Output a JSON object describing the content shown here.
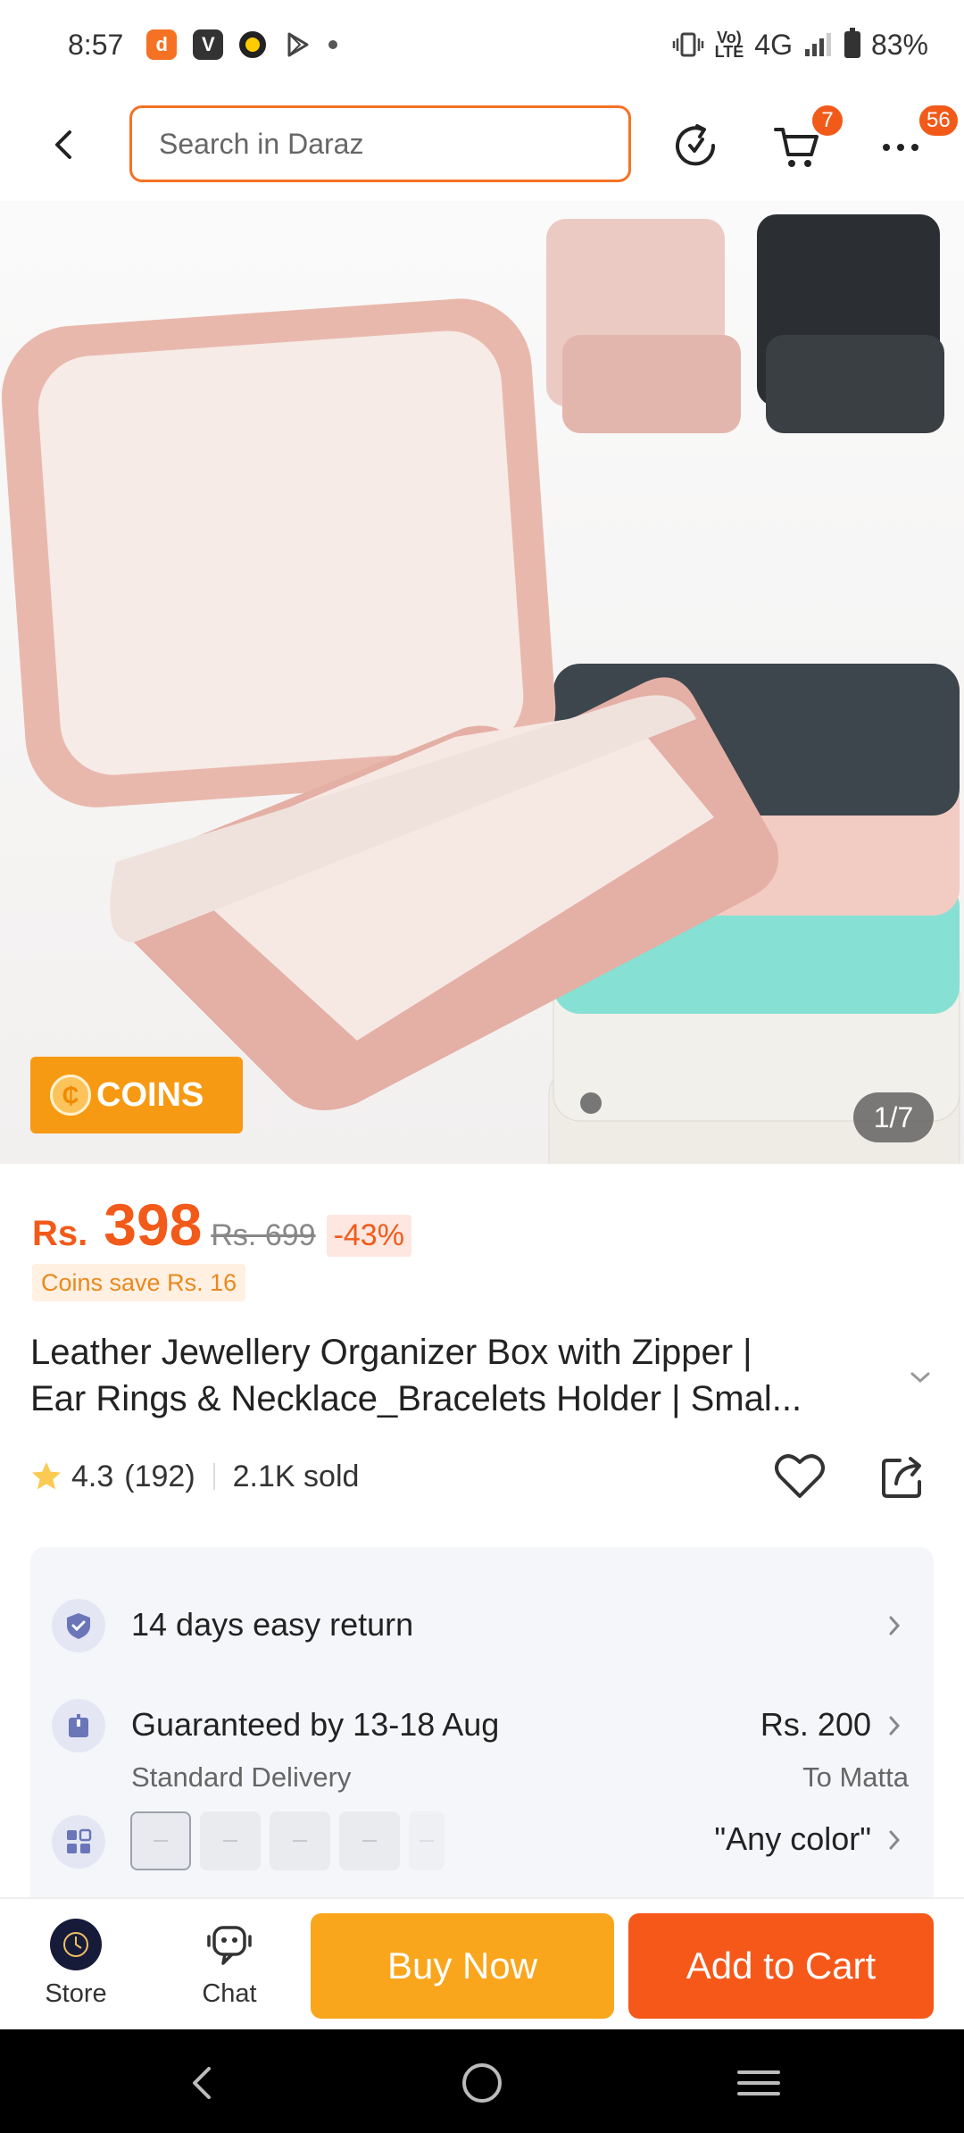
{
  "status_bar": {
    "time": "8:57",
    "network": "4G",
    "volte_line1": "Vo)",
    "volte_line2": "LTE",
    "battery": "83%",
    "app_icons": [
      "daraz-app-icon",
      "v-app-icon",
      "ring-app-icon",
      "play-store-icon",
      "notification-dot"
    ]
  },
  "header": {
    "search_placeholder": "Search in Daraz",
    "cart_badge": "7",
    "more_badge": "56",
    "icons": [
      "back-arrow-icon",
      "reload-icon",
      "cart-icon",
      "more-icon"
    ]
  },
  "gallery": {
    "coins_label": "COINS",
    "page_indicator": "1/7"
  },
  "price": {
    "currency": "Rs.",
    "current": "398",
    "original": "Rs. 699",
    "discount": "-43%",
    "coins_save": "Coins save Rs. 16"
  },
  "product": {
    "title_line1": "Leather Jewellery Organizer Box with Zipper |",
    "title_line2": "Ear Rings & Necklace_Bracelets Holder | Smal...",
    "rating": "4.3",
    "reviews": "(192)",
    "sold": "2.1K sold"
  },
  "info": {
    "return_text": "14 days easy return",
    "delivery_text": "Guaranteed by 13-18 Aug",
    "delivery_type": "Standard Delivery",
    "delivery_price": "Rs. 200",
    "delivery_location": "To Matta",
    "color_text": "\"Any color\""
  },
  "action_bar": {
    "store_label": "Store",
    "chat_label": "Chat",
    "buy_now": "Buy Now",
    "add_to_cart": "Add to Cart"
  },
  "colors": {
    "brand_orange": "#f57224",
    "buy_now": "#faa61c",
    "add_to_cart": "#f6581a",
    "price": "#f25a1a"
  }
}
